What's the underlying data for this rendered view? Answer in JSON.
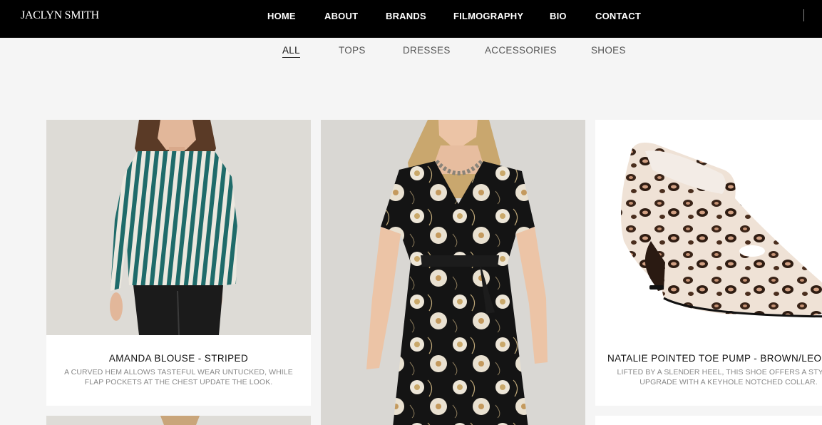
{
  "header": {
    "logo": "JACLYN SMITH",
    "nav": [
      "HOME",
      "ABOUT",
      "BRANDS",
      "FILMOGRAPHY",
      "BIO",
      "CONTACT"
    ]
  },
  "filters": {
    "items": [
      "ALL",
      "TOPS",
      "DRESSES",
      "ACCESSORIES",
      "SHOES"
    ],
    "active": "ALL"
  },
  "products": [
    {
      "title": "AMANDA BLOUSE - STRIPED",
      "description": "A CURVED HEM ALLOWS TASTEFUL WEAR UNTUCKED, WHILE FLAP POCKETS AT THE CHEST UPDATE THE LOOK."
    },
    {
      "title": "",
      "description": ""
    },
    {
      "title": "NATALIE POINTED TOE PUMP - BROWN/LEOPARD",
      "description": "LIFTED BY A SLENDER HEEL, THIS SHOE OFFERS A STYLISH UPGRADE WITH A KEYHOLE NOTCHED COLLAR."
    }
  ],
  "colors": {
    "header_bg": "#000000",
    "page_bg": "#f5f5f5",
    "card_bg": "#ffffff",
    "desc_text": "#888888"
  }
}
